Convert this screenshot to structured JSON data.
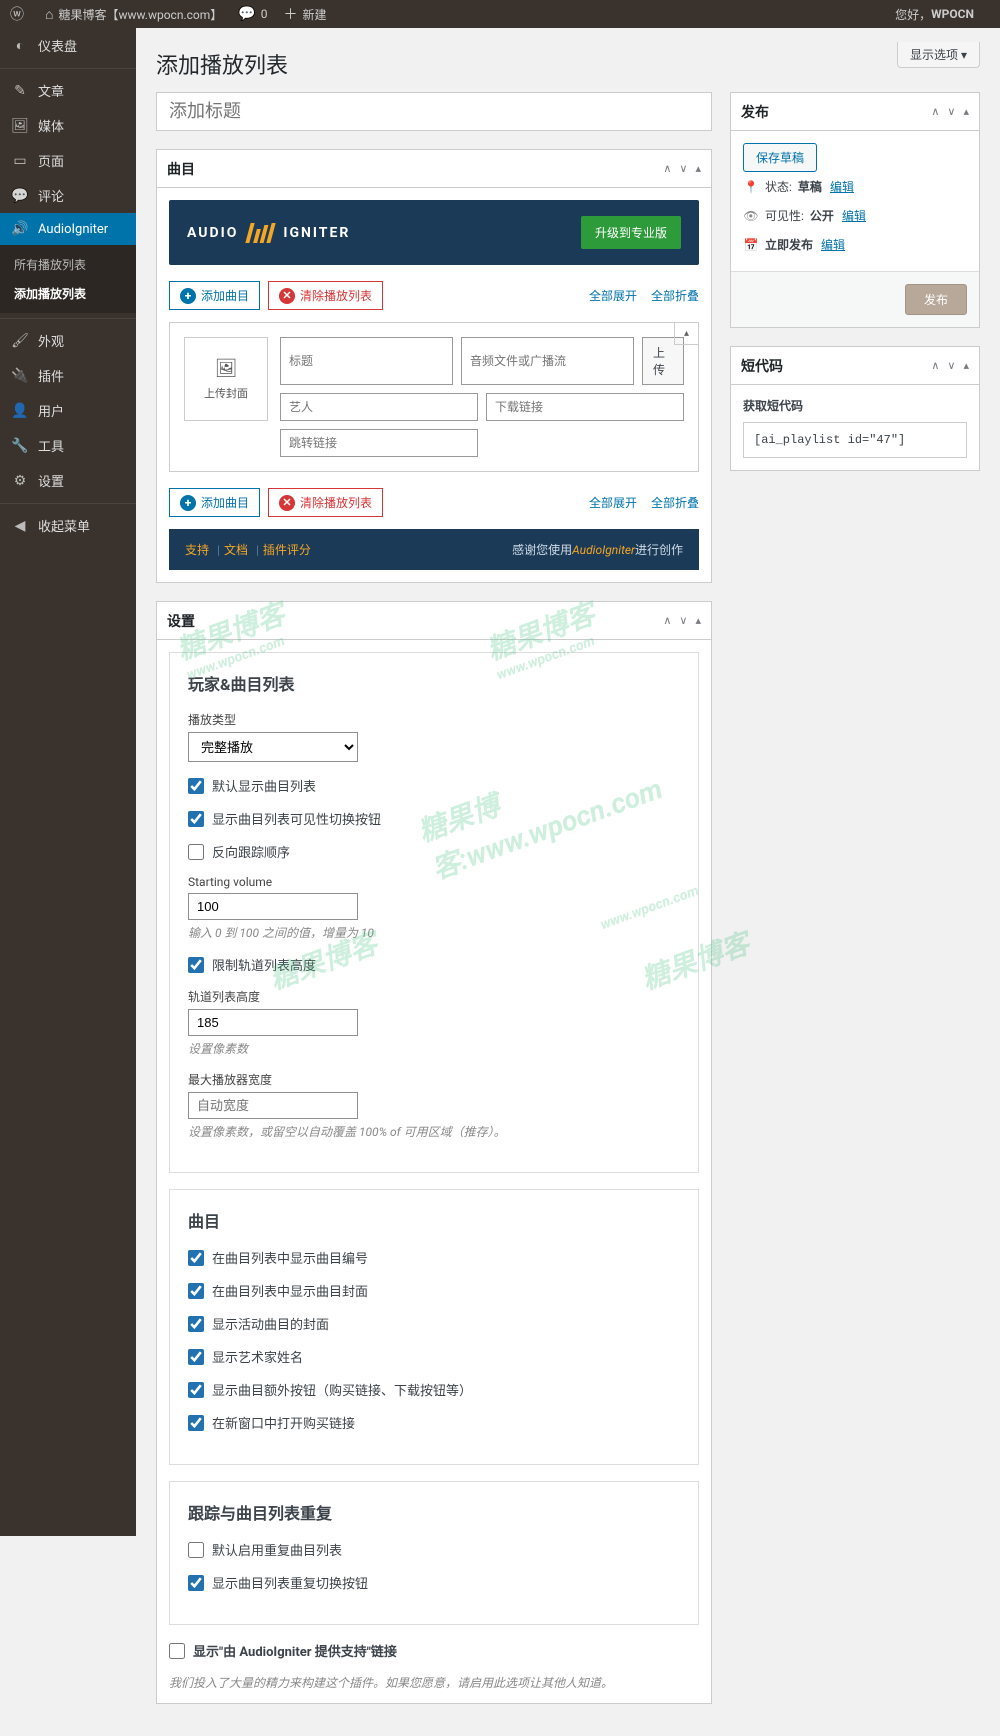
{
  "adminbar": {
    "site_name": "糖果博客【www.wpocn.com】",
    "comments": "0",
    "new": "新建",
    "greeting": "您好，",
    "user": "WPOCN"
  },
  "sidebar": {
    "items": [
      {
        "icon": "◐",
        "label": "仪表盘"
      },
      {
        "icon": "✎",
        "label": "文章"
      },
      {
        "icon": "🖼",
        "label": "媒体"
      },
      {
        "icon": "▭",
        "label": "页面"
      },
      {
        "icon": "💬",
        "label": "评论"
      },
      {
        "icon": "🔊",
        "label": "AudioIgniter"
      },
      {
        "icon": "🖌",
        "label": "外观"
      },
      {
        "icon": "🔌",
        "label": "插件"
      },
      {
        "icon": "👤",
        "label": "用户"
      },
      {
        "icon": "🔧",
        "label": "工具"
      },
      {
        "icon": "⚙",
        "label": "设置"
      },
      {
        "icon": "◀",
        "label": "收起菜单"
      }
    ],
    "submenu": {
      "all": "所有播放列表",
      "add": "添加播放列表"
    }
  },
  "page": {
    "title": "添加播放列表",
    "screen_options": "显示选项",
    "title_placeholder": "添加标题"
  },
  "tracks_box": {
    "heading": "曲目",
    "logo_left": "AUDIO",
    "logo_right": "IGNITER",
    "upgrade": "升级到专业版",
    "add": "添加曲目",
    "clear": "清除播放列表",
    "expand": "全部展开",
    "collapse": "全部折叠",
    "upload_cover": "上传封面",
    "ph_title": "标题",
    "ph_file": "音频文件或广播流",
    "btn_upload": "上传",
    "ph_artist": "艺人",
    "ph_download": "下载链接",
    "ph_jump": "跳转链接",
    "footer_support": "支持",
    "footer_docs": "文档",
    "footer_review": "插件评分",
    "footer_thanks_pre": "感谢您使用",
    "footer_thanks_brand": "AudioIgniter",
    "footer_thanks_post": "进行创作"
  },
  "settings_box": {
    "heading": "设置",
    "sec1_title": "玩家&曲目列表",
    "play_type_label": "播放类型",
    "play_type_value": "完整播放",
    "cb_default_show": "默认显示曲目列表",
    "cb_show_toggle": "显示曲目列表可见性切换按钮",
    "cb_reverse": "反向跟踪顺序",
    "vol_label": "Starting volume",
    "vol_value": "100",
    "vol_hint": "输入 0 到 100 之间的值，增量为 10",
    "cb_limit_height": "限制轨道列表高度",
    "height_label": "轨道列表高度",
    "height_value": "185",
    "height_hint": "设置像素数",
    "maxw_label": "最大播放器宽度",
    "maxw_ph": "自动宽度",
    "maxw_hint": "设置像素数，或留空以自动覆盖 100% of 可用区域（推存）。",
    "sec2_title": "曲目",
    "cb_s2_1": "在曲目列表中显示曲目编号",
    "cb_s2_2": "在曲目列表中显示曲目封面",
    "cb_s2_3": "显示活动曲目的封面",
    "cb_s2_4": "显示艺术家姓名",
    "cb_s2_5": "显示曲目额外按钮（购买链接、下载按钮等）",
    "cb_s2_6": "在新窗口中打开购买链接",
    "sec3_title": "跟踪与曲目列表重复",
    "cb_s3_1": "默认启用重复曲目列表",
    "cb_s3_2": "显示曲目列表重复切换按钮",
    "cb_powered": "显示\"由 AudioIgniter 提供支持\"链接",
    "powered_hint": "我们投入了大量的精力来构建这个插件。如果您愿意，请启用此选项让其他人知道。"
  },
  "publish": {
    "heading": "发布",
    "save_draft": "保存草稿",
    "status_lbl": "状态:",
    "status_val": "草稿",
    "edit": "编辑",
    "vis_lbl": "可见性:",
    "vis_val": "公开",
    "sched_lbl": "立即发布",
    "publish_btn": "发布"
  },
  "shortcode": {
    "heading": "短代码",
    "get": "获取短代码",
    "code": "[ai_playlist id=\"47\"]"
  }
}
